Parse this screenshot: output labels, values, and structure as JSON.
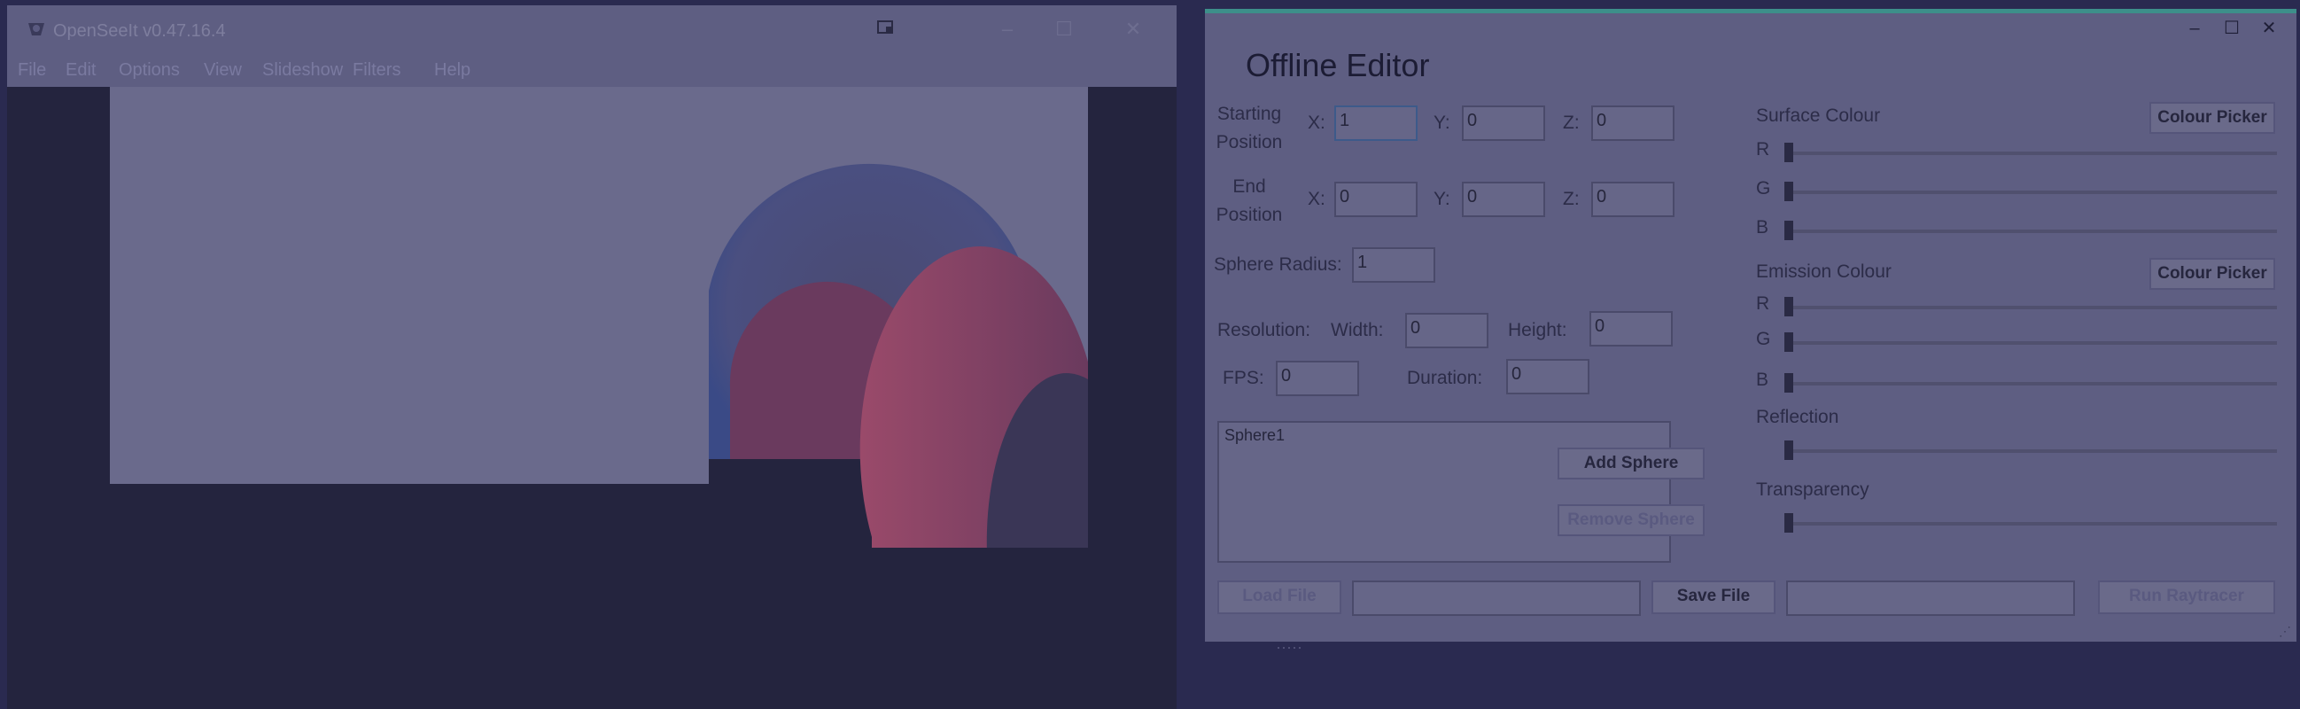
{
  "viewer": {
    "title": "OpenSeeIt v0.47.16.4",
    "menu": [
      "File",
      "Edit",
      "Options",
      "View",
      "Slideshow",
      "Filters",
      "Help"
    ]
  },
  "editor": {
    "title": "Offline Editor",
    "starting_position": {
      "label_line1": "Starting",
      "label_line2": "Position",
      "x": "1",
      "y": "0",
      "z": "0"
    },
    "end_position": {
      "label_line1": "End",
      "label_line2": "Position",
      "x": "0",
      "y": "0",
      "z": "0"
    },
    "axis_labels": {
      "x": "X:",
      "y": "Y:",
      "z": "Z:"
    },
    "sphere_radius": {
      "label": "Sphere Radius:",
      "value": "1"
    },
    "resolution": {
      "label": "Resolution:",
      "width_label": "Width:",
      "width": "0",
      "height_label": "Height:",
      "height": "0"
    },
    "fps": {
      "label": "FPS:",
      "value": "0",
      "duration_label": "Duration:",
      "duration": "0"
    },
    "sphere_list": [
      "Sphere1"
    ],
    "buttons": {
      "add_sphere": "Add Sphere",
      "remove_sphere": "Remove Sphere",
      "load_file": "Load File",
      "save_file": "Save File",
      "run_raytracer": "Run Raytracer"
    },
    "surface_colour": {
      "label": "Surface Colour",
      "picker": "Colour Picker",
      "r": "R",
      "g": "G",
      "b": "B"
    },
    "emission_colour": {
      "label": "Emission Colour",
      "picker": "Colour Picker",
      "r": "R",
      "g": "G",
      "b": "B"
    },
    "reflection": {
      "label": "Reflection"
    },
    "transparency": {
      "label": "Transparency"
    }
  },
  "colors": {
    "accent": "#3d8f8a",
    "panel": "#5e5e82",
    "background": "#2a2a50"
  }
}
